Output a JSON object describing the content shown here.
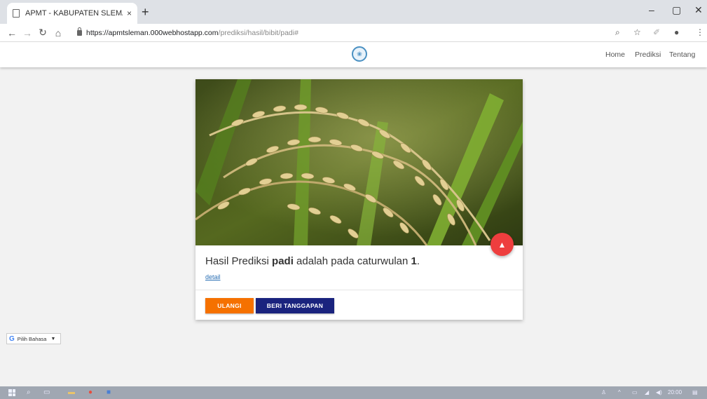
{
  "browser": {
    "tab_title": "APMT - KABUPATEN SLEMAN",
    "tab_close": "×",
    "new_tab": "+",
    "url_host": "https://apmtsleman.000webhostapp.com",
    "url_path": "/prediksi/hasil/bibit/padi#"
  },
  "site": {
    "nav": [
      "Home",
      "Prediksi",
      "Tentang"
    ]
  },
  "card": {
    "result_prefix": "Hasil Prediksi ",
    "crop": "padi",
    "result_middle": " adalah pada caturwulan ",
    "period": "1",
    "result_suffix": ".",
    "detail_link": "detail",
    "fab_icon": "chevron-up-icon",
    "buttons": {
      "ulangi": "ULANGI",
      "beri_tanggapan": "BERI TANGGAPAN"
    }
  },
  "language": {
    "label": "Pilih Bahasa"
  },
  "taskbar": {
    "clock": "20:00"
  },
  "colors": {
    "fab": "#ee3e3e",
    "btn_ulangi": "#f57100",
    "btn_tanggapan": "#1a237e",
    "link": "#2a6fb4"
  }
}
